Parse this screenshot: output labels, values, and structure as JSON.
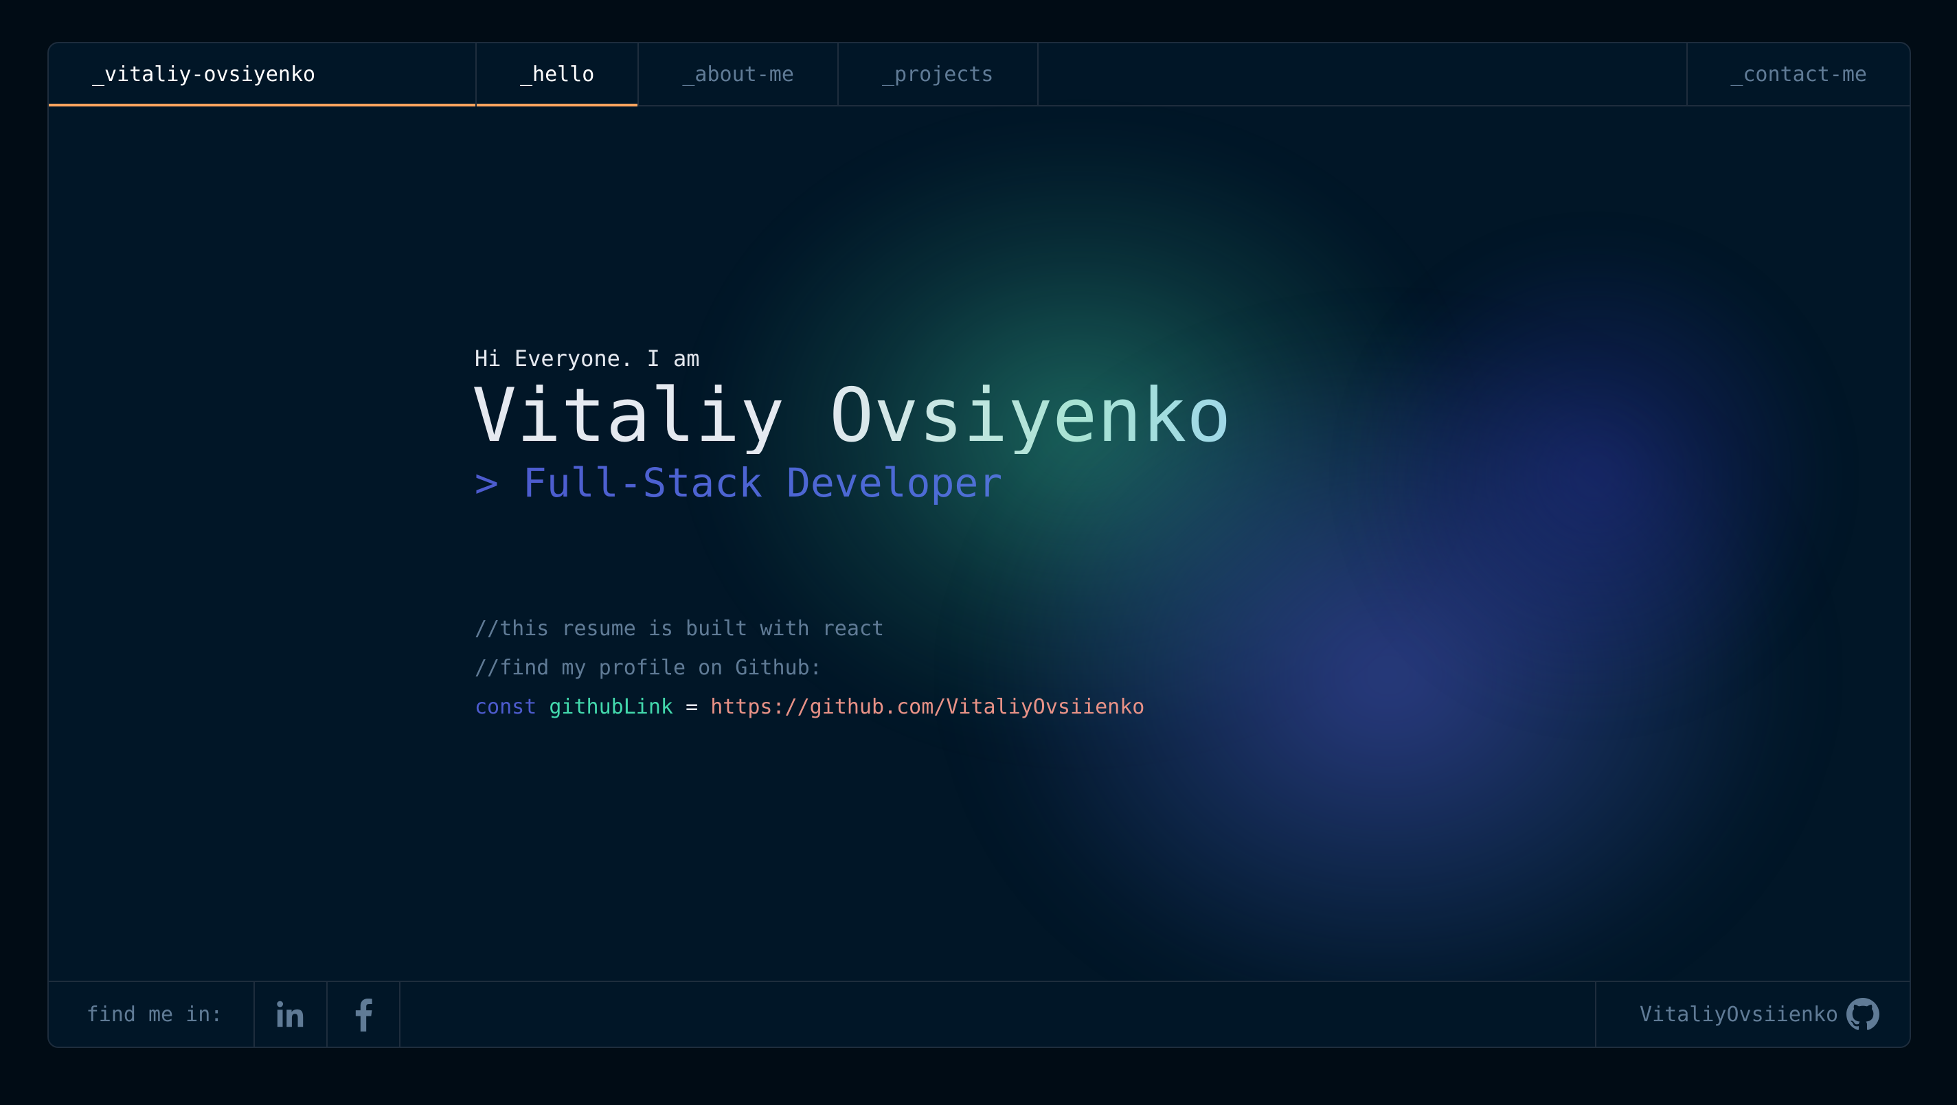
{
  "header": {
    "brand": "_vitaliy-ovsiyenko",
    "tabs": [
      {
        "label": "_hello",
        "active": true
      },
      {
        "label": "_about-me",
        "active": false
      },
      {
        "label": "_projects",
        "active": false
      }
    ],
    "contact": "_contact-me"
  },
  "hero": {
    "greeting": "Hi Everyone. I am",
    "name": "Vitaliy Ovsiyenko",
    "role": "> Full-Stack Developer"
  },
  "code": {
    "comment1": "//this resume is built with react",
    "comment2": "//find my profile on Github:",
    "keyword": "const",
    "variable": "githubLink",
    "operator": "=",
    "value": "https://github.com/VitaliyOvsiienko"
  },
  "footer": {
    "find_label": "find me in:",
    "social": [
      "linkedin-icon",
      "facebook-icon"
    ],
    "github_user": "VitaliyOvsiienko"
  },
  "colors": {
    "accent_orange": "#fea55f",
    "keyword": "#4d5bce",
    "variable": "#43d9ad",
    "string": "#e99287",
    "muted": "#607b96",
    "background": "#011627"
  }
}
